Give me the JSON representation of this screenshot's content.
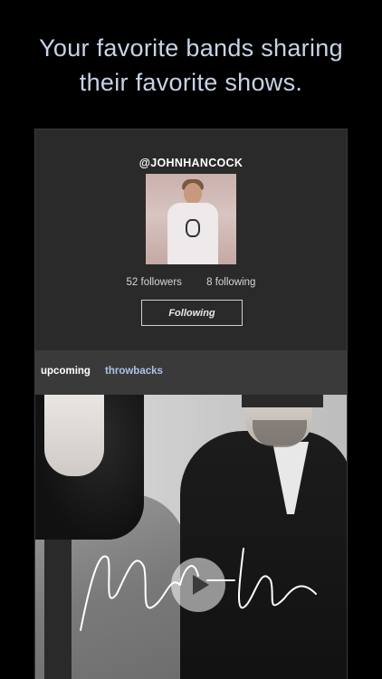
{
  "headline": {
    "line1": "Your favorite bands sharing",
    "line2": "their favorite shows."
  },
  "profile": {
    "username": "@JOHNHANCOCK",
    "followers": "52 followers",
    "following": "8 following",
    "follow_button_label": "Following"
  },
  "tabs": [
    {
      "label": "upcoming",
      "active": true
    },
    {
      "label": "throwbacks",
      "active": false
    }
  ],
  "video": {
    "play_icon": "play-icon"
  },
  "colors": {
    "background": "#000000",
    "headline": "#c7d3e6",
    "panel": "#2a2a2a",
    "tab_bar": "#3a3a3a",
    "link_blue": "#a9c2e6"
  }
}
